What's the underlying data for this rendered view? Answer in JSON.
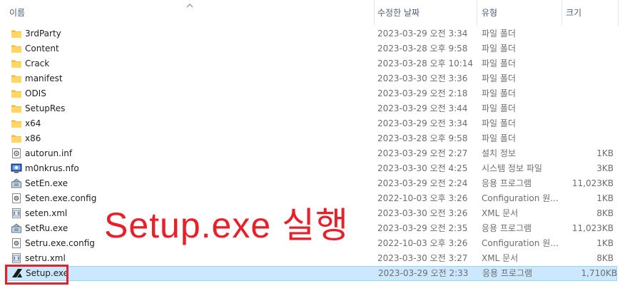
{
  "columns": {
    "name": "이름",
    "date": "수정한 날짜",
    "type": "유형",
    "size": "크기"
  },
  "files": [
    {
      "name": "3rdParty",
      "date": "2023-03-29 오전 3:34",
      "type": "파일 폴더",
      "size": "",
      "icon": "folder-icon"
    },
    {
      "name": "Content",
      "date": "2023-03-28 오후 9:58",
      "type": "파일 폴더",
      "size": "",
      "icon": "folder-icon"
    },
    {
      "name": "Crack",
      "date": "2023-03-28 오후 10:14",
      "type": "파일 폴더",
      "size": "",
      "icon": "folder-icon"
    },
    {
      "name": "manifest",
      "date": "2023-03-30 오전 3:36",
      "type": "파일 폴더",
      "size": "",
      "icon": "folder-icon"
    },
    {
      "name": "ODIS",
      "date": "2023-03-29 오전 2:18",
      "type": "파일 폴더",
      "size": "",
      "icon": "folder-icon"
    },
    {
      "name": "SetupRes",
      "date": "2023-03-29 오전 3:44",
      "type": "파일 폴더",
      "size": "",
      "icon": "folder-icon"
    },
    {
      "name": "x64",
      "date": "2023-03-29 오전 3:34",
      "type": "파일 폴더",
      "size": "",
      "icon": "folder-icon"
    },
    {
      "name": "x86",
      "date": "2023-03-28 오후 9:58",
      "type": "파일 폴더",
      "size": "",
      "icon": "folder-icon"
    },
    {
      "name": "autorun.inf",
      "date": "2023-03-29 오전 2:27",
      "type": "설치 정보",
      "size": "1KB",
      "icon": "setup-info-icon"
    },
    {
      "name": "m0nkrus.nfo",
      "date": "2023-03-30 오전 4:25",
      "type": "시스템 정보 파일",
      "size": "3KB",
      "icon": "system-info-icon"
    },
    {
      "name": "SetEn.exe",
      "date": "2023-03-29 오전 2:24",
      "type": "응용 프로그램",
      "size": "11,023KB",
      "icon": "installer-exe-icon"
    },
    {
      "name": "Seten.exe.config",
      "date": "2022-10-03 오후 3:26",
      "type": "Configuration 원...",
      "size": "1KB",
      "icon": "config-file-icon"
    },
    {
      "name": "seten.xml",
      "date": "2023-03-30 오전 3:26",
      "type": "XML 문서",
      "size": "8KB",
      "icon": "xml-file-icon"
    },
    {
      "name": "SetRu.exe",
      "date": "2023-03-29 오전 2:35",
      "type": "응용 프로그램",
      "size": "11,023KB",
      "icon": "installer-exe-icon"
    },
    {
      "name": "Setru.exe.config",
      "date": "2022-10-03 오후 3:26",
      "type": "Configuration 원...",
      "size": "1KB",
      "icon": "config-file-icon"
    },
    {
      "name": "setru.xml",
      "date": "2023-03-30 오전 3:27",
      "type": "XML 문서",
      "size": "8KB",
      "icon": "xml-file-icon"
    },
    {
      "name": "Setup.exe",
      "date": "2023-03-29 오전 2:33",
      "type": "응용 프로그램",
      "size": "1,710KB",
      "icon": "autodesk-logo-icon"
    }
  ],
  "annotation": "Setup.exe 실행",
  "colors": {
    "annotation": "#e8202a",
    "selection": "#cce8ff",
    "selection_border": "#99d1ff",
    "folder": "#ffd767"
  }
}
